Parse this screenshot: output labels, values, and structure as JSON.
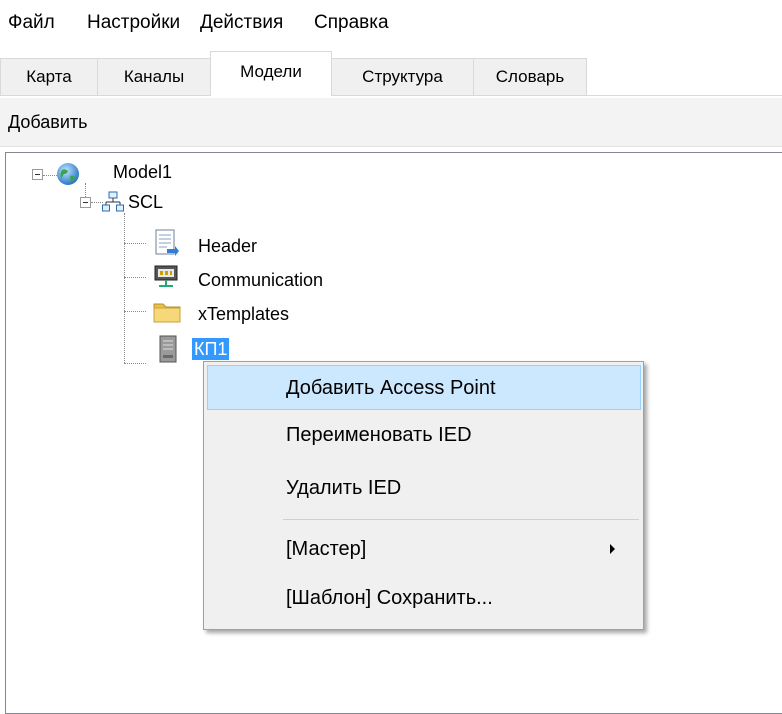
{
  "menubar": {
    "items": [
      "Файл",
      "Настройки",
      "Действия",
      "Справка"
    ]
  },
  "tabs": {
    "items": [
      "Карта",
      "Каналы",
      "Модели",
      "Структура",
      "Словарь"
    ],
    "active": "Модели"
  },
  "toolbar": {
    "add_label": "Добавить"
  },
  "tree": {
    "root": {
      "label": "Model1",
      "icon": "globe-icon"
    },
    "scl": {
      "label": "SCL",
      "icon": "network-icon"
    },
    "children": [
      {
        "label": "Header",
        "icon": "document-icon"
      },
      {
        "label": "Communication",
        "icon": "network-card-icon"
      },
      {
        "label": "xTemplates",
        "icon": "folder-icon"
      },
      {
        "label": "КП1",
        "icon": "server-icon",
        "selected": true
      }
    ]
  },
  "context_menu": {
    "items": [
      {
        "label": "Добавить Access Point",
        "highlighted": true
      },
      {
        "label": "Переименовать IED"
      },
      {
        "label": "Удалить IED"
      },
      {
        "label": "[Мастер]",
        "submenu": true
      },
      {
        "label": "[Шаблон] Сохранить..."
      }
    ]
  },
  "colors": {
    "selection": "#3399ff",
    "menu_highlight": "#cce8ff",
    "menu_highlight_border": "#99d1ff",
    "menu_background": "#f0f0f0"
  }
}
